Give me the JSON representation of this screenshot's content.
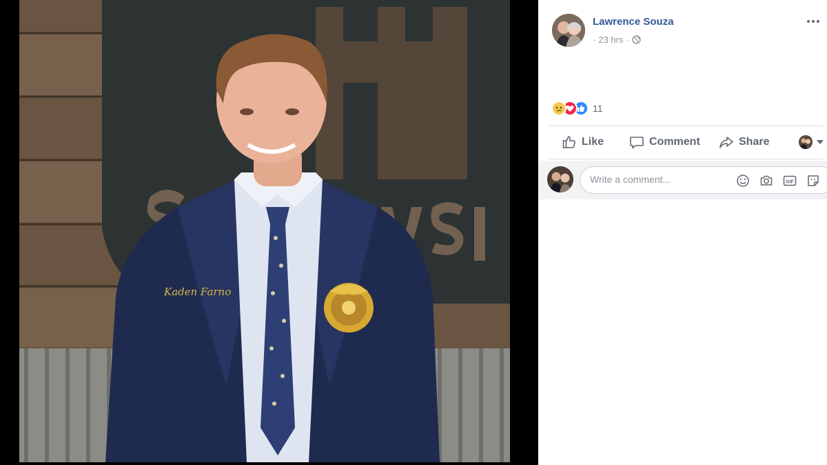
{
  "post": {
    "author": "Lawrence Souza",
    "time": "23 hrs",
    "separator": "·"
  },
  "reactions": {
    "types": [
      "sad-reaction-icon",
      "love-reaction-icon",
      "like-reaction-icon"
    ],
    "count": "11"
  },
  "actions": {
    "like": "Like",
    "comment": "Comment",
    "share": "Share"
  },
  "comment_box": {
    "placeholder": "Write a comment...",
    "icons": [
      "emoji-icon",
      "camera-icon",
      "gif-icon",
      "sticker-icon"
    ]
  },
  "photo": {
    "jacket_name": "Kaden Farno"
  },
  "colors": {
    "link": "#365899",
    "muted": "#606770",
    "meta": "#90949c",
    "jacket": "#1f2a4f",
    "emblem": "#d8a930"
  }
}
